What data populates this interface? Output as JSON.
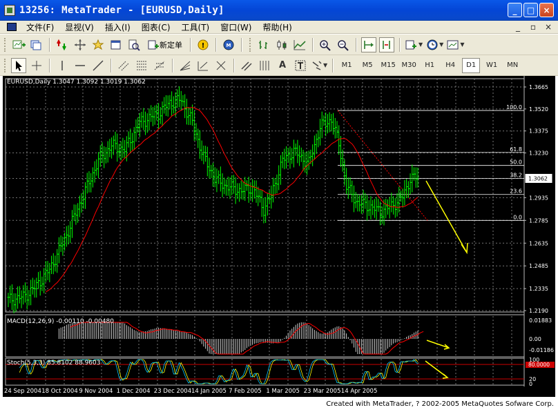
{
  "window": {
    "title": "13256: MetaTrader - [EURUSD,Daily]",
    "buttons": [
      "_",
      "□",
      "×"
    ]
  },
  "menu": {
    "items": [
      "文件(F)",
      "显视(V)",
      "插入(I)",
      "图表(C)",
      "工具(T)",
      "窗口(W)",
      "帮助(H)"
    ],
    "mdi_buttons": [
      "_",
      "▫",
      "×"
    ]
  },
  "toolbar1": {
    "new_order_label": "新定单"
  },
  "toolbar2": {
    "text_tool": "A",
    "timeframes": [
      "M1",
      "M5",
      "M15",
      "M30",
      "H1",
      "H4",
      "D1",
      "W1",
      "MN"
    ],
    "active_timeframe": "D1"
  },
  "chart": {
    "header": "EURUSD,Daily  1.3047 1.3092 1.3019 1.3062",
    "price_ticks": [
      "1.3665",
      "1.3520",
      "1.3375",
      "1.3230",
      "1.3062",
      "1.2935",
      "1.2785",
      "1.2635",
      "1.2485",
      "1.2335",
      "1.2190"
    ],
    "current_price": "1.3062",
    "fib_levels": [
      "100.0",
      "61.8",
      "50.0",
      "38.2",
      "23.6",
      "0.0"
    ],
    "date_ticks": [
      "24 Sep 2004",
      "18 Oct 2004",
      "9 Nov 2004",
      "1 Dec 2004",
      "23 Dec 2004",
      "14 Jan 2005",
      "7 Feb 2005",
      "1 Mar 2005",
      "23 Mar 2005",
      "14 Apr 2005"
    ],
    "macd_label": "MACD(12,26,9) -0.00110 -0.00480",
    "macd_ticks": [
      "0.01883",
      "0.00",
      "-0.01186"
    ],
    "stoch_label": "Stoch(5,3,3) 85.8102 88.9603",
    "stoch_ticks": [
      "100",
      "80",
      "20",
      "0"
    ],
    "stoch_marker": "80.0000",
    "colors": {
      "background": "#000000",
      "bull_bar": "#00ff00",
      "moving_average": "#ff0000",
      "arrow": "#ffff00",
      "fib": "#ffffff",
      "stoch_main": "#00ccff",
      "stoch_signal": "#ffff00"
    }
  },
  "footer": {
    "copyright": "Created with MetaTrader, ? 2002-2005 MetaQuotes Sofware Corp."
  }
}
